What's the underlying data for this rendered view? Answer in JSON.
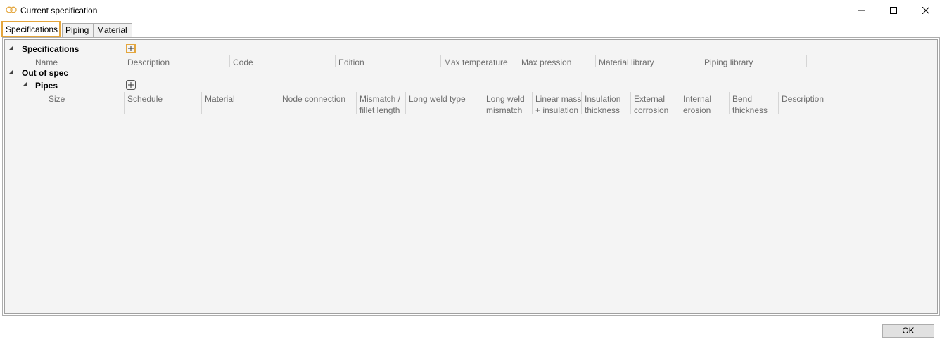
{
  "window": {
    "title": "Current specification",
    "icon": "two-rings-icon",
    "controls": [
      "minimize",
      "maximize",
      "close"
    ]
  },
  "tabs": [
    {
      "label": "Specifications",
      "active": true
    },
    {
      "label": "Piping",
      "active": false
    },
    {
      "label": "Material",
      "active": false
    }
  ],
  "specifications": {
    "label": "Specifications",
    "columns": [
      "Name",
      "Description",
      "Code",
      "Edition",
      "Max temperature",
      "Max pression",
      "Material library",
      "Piping library"
    ]
  },
  "out_of_spec": {
    "label": "Out of spec",
    "pipes": {
      "label": "Pipes",
      "columns": [
        [
          "Size"
        ],
        [
          "Schedule"
        ],
        [
          "Material"
        ],
        [
          "Node connection"
        ],
        [
          "Mismatch /",
          "fillet length"
        ],
        [
          "Long weld type"
        ],
        [
          "Long weld",
          "mismatch"
        ],
        [
          "Linear mass",
          "+ insulation"
        ],
        [
          "Insulation",
          "thickness"
        ],
        [
          "External",
          "corrosion"
        ],
        [
          "Internal",
          "erosion"
        ],
        [
          "Bend",
          "thickness"
        ],
        [
          "Description"
        ]
      ]
    }
  },
  "footer": {
    "ok_label": "OK"
  },
  "colors": {
    "highlight": "#e4a63d",
    "panel_bg": "#f4f4f4",
    "header_text": "#6d6d6d"
  }
}
